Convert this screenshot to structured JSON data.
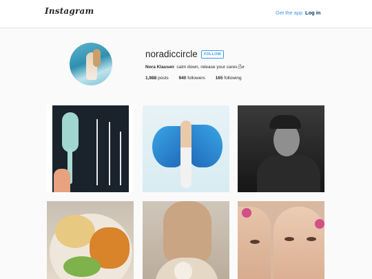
{
  "header": {
    "logo": "Instagram",
    "get_app": "Get the app",
    "login": "Log in"
  },
  "profile": {
    "username": "noradiccircle",
    "follow_label": "FOLLOW",
    "full_name": "Nora Klausen",
    "bio": "calm down, release your cares 🌬",
    "stats": {
      "posts_count": "1,988",
      "posts_label": "posts",
      "followers_count": "940",
      "followers_label": "followers",
      "following_count": "165",
      "following_label": "following"
    }
  },
  "colors": {
    "accent": "#3897f0",
    "login": "#003569",
    "background": "#fafafa"
  },
  "posts": [
    {
      "subject": "hairbrush and kitchen tools on dark board"
    },
    {
      "subject": "woman with blue butterfly wings"
    },
    {
      "subject": "man in cap, black and white"
    },
    {
      "subject": "plate of rice and chicken"
    },
    {
      "subject": "person holding a small dog"
    },
    {
      "subject": "woman with pink curlers, makeup"
    }
  ]
}
